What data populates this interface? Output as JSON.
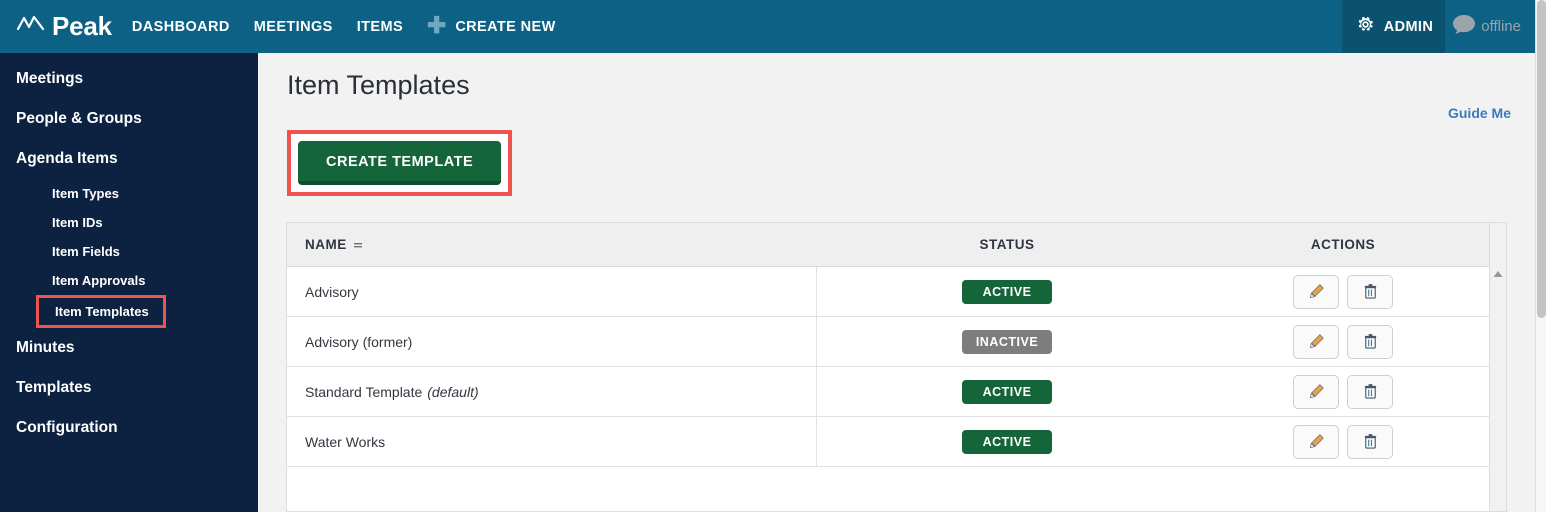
{
  "header": {
    "logo_text": "Peak",
    "logo_icon": "zigzag-peak-icon",
    "nav": [
      {
        "label": "DASHBOARD",
        "name": "dashboard"
      },
      {
        "label": "MEETINGS",
        "name": "meetings"
      },
      {
        "label": "ITEMS",
        "name": "items"
      }
    ],
    "create_new": {
      "label": "CREATE NEW",
      "icon": "plus-icon"
    },
    "admin": {
      "label": "ADMIN",
      "icon": "gear-icon"
    },
    "status": {
      "label": "offline",
      "icon": "chat-bubble-icon"
    },
    "colors": {
      "bar": "#0d6185",
      "admin_block": "#0b526f",
      "status_text": "#9aa5ab"
    }
  },
  "sidebar": {
    "items": [
      {
        "label": "Meetings",
        "level": "top"
      },
      {
        "label": "People & Groups",
        "level": "top"
      },
      {
        "label": "Agenda Items",
        "level": "top"
      },
      {
        "label": "Item Types",
        "level": "sub"
      },
      {
        "label": "Item IDs",
        "level": "sub"
      },
      {
        "label": "Item Fields",
        "level": "sub"
      },
      {
        "label": "Item Approvals",
        "level": "sub"
      },
      {
        "label": "Item Templates",
        "level": "sub",
        "highlighted": true
      },
      {
        "label": "Minutes",
        "level": "top"
      },
      {
        "label": "Templates",
        "level": "top"
      },
      {
        "label": "Configuration",
        "level": "top"
      }
    ],
    "colors": {
      "background": "#0d2240",
      "highlight_border": "#ef5350"
    }
  },
  "main": {
    "title": "Item Templates",
    "guide_me": "Guide Me",
    "create_button": "CREATE TEMPLATE",
    "create_button_annotated": true,
    "colors": {
      "button": "#15653a",
      "annotation": "#ef5350",
      "link": "#3a7bbf"
    }
  },
  "table": {
    "columns": [
      {
        "label": "NAME",
        "sort_icon": "sort-icon"
      },
      {
        "label": "STATUS"
      },
      {
        "label": "ACTIONS"
      }
    ],
    "rows": [
      {
        "name": "Advisory",
        "suffix": "",
        "status": "ACTIVE",
        "status_type": "active",
        "actions": [
          {
            "icon": "pencil-edit-icon"
          },
          {
            "icon": "trash-delete-icon"
          }
        ]
      },
      {
        "name": "Advisory (former)",
        "suffix": "",
        "status": "INACTIVE",
        "status_type": "inactive",
        "actions": [
          {
            "icon": "pencil-edit-icon"
          },
          {
            "icon": "trash-delete-icon"
          }
        ]
      },
      {
        "name": "Standard Template",
        "suffix": "(default)",
        "status": "ACTIVE",
        "status_type": "active",
        "actions": [
          {
            "icon": "pencil-edit-icon"
          },
          {
            "icon": "trash-delete-icon"
          }
        ]
      },
      {
        "name": "Water Works",
        "suffix": "",
        "status": "ACTIVE",
        "status_type": "active",
        "actions": [
          {
            "icon": "pencil-edit-icon"
          },
          {
            "icon": "trash-delete-icon"
          }
        ]
      }
    ],
    "badge_colors": {
      "active": "#15653a",
      "inactive": "#7d7d7d"
    }
  }
}
